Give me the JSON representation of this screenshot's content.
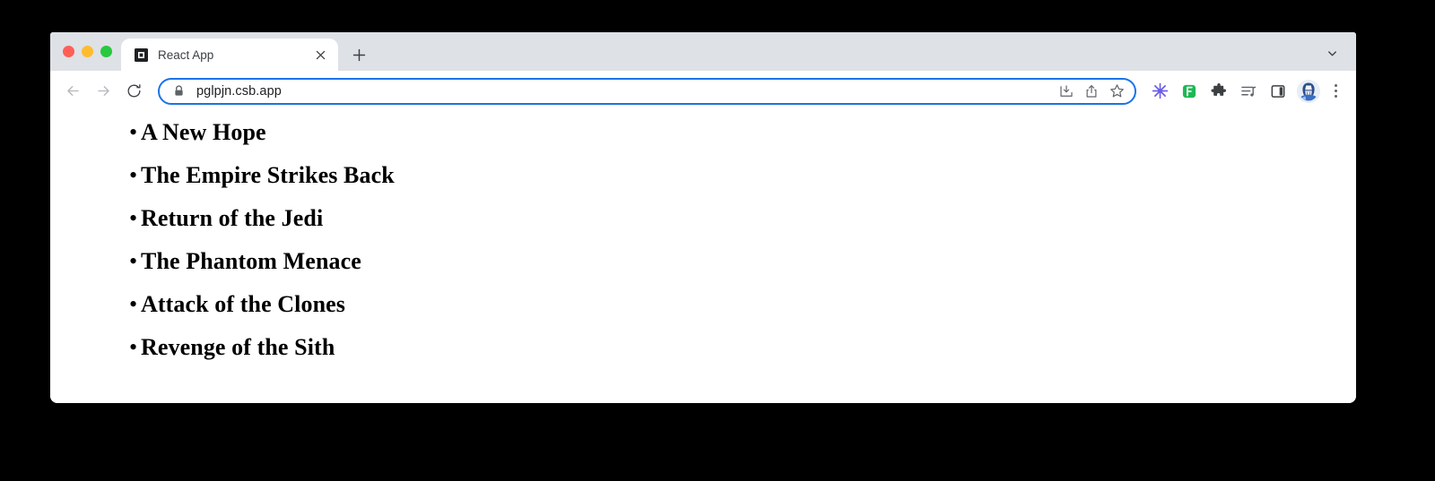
{
  "window": {
    "traffic_lights": [
      {
        "name": "close",
        "color": "#ff5f57"
      },
      {
        "name": "minimize",
        "color": "#febc2e"
      },
      {
        "name": "maximize",
        "color": "#28c840"
      }
    ]
  },
  "tab_strip": {
    "tabs": [
      {
        "title": "React App",
        "favicon": "nested-square-icon",
        "close_label": "×",
        "active": true
      }
    ],
    "new_tab_label": "+",
    "tab_search_icon": "chevron-down-icon"
  },
  "toolbar": {
    "back_icon": "back-arrow-icon",
    "forward_icon": "forward-arrow-icon",
    "reload_icon": "reload-icon",
    "omnibox": {
      "url": "pglpjn.csb.app",
      "placeholder": "Search Google or type a URL",
      "lock_icon": "lock-icon",
      "actions": [
        {
          "name": "install-app-icon"
        },
        {
          "name": "share-icon"
        },
        {
          "name": "bookmark-star-icon"
        }
      ],
      "focus_color": "#1a73e8"
    },
    "extensions": [
      {
        "name": "asterisk-extension-icon",
        "color": "#6b5ce7"
      },
      {
        "name": "f-badge-extension-icon",
        "color": "#1db954",
        "label": "F"
      },
      {
        "name": "puzzle-extensions-icon",
        "color": "#5f6368"
      },
      {
        "name": "media-playlist-icon",
        "color": "#5f6368"
      },
      {
        "name": "side-panel-icon",
        "color": "#5f6368"
      }
    ],
    "profile_avatar": "user-avatar",
    "menu_icon": "three-dot-menu-icon"
  },
  "page": {
    "list": {
      "bullet": "•",
      "items": [
        {
          "title": "A New Hope"
        },
        {
          "title": "The Empire Strikes Back"
        },
        {
          "title": "Return of the Jedi"
        },
        {
          "title": "The Phantom Menace"
        },
        {
          "title": "Attack of the Clones"
        },
        {
          "title": "Revenge of the Sith"
        }
      ]
    }
  },
  "colors": {
    "tab_strip_bg": "#dee1e6",
    "toolbar_bg": "#ffffff",
    "page_bg": "#ffffff",
    "frame_bg": "#000000",
    "text": "#000000"
  }
}
